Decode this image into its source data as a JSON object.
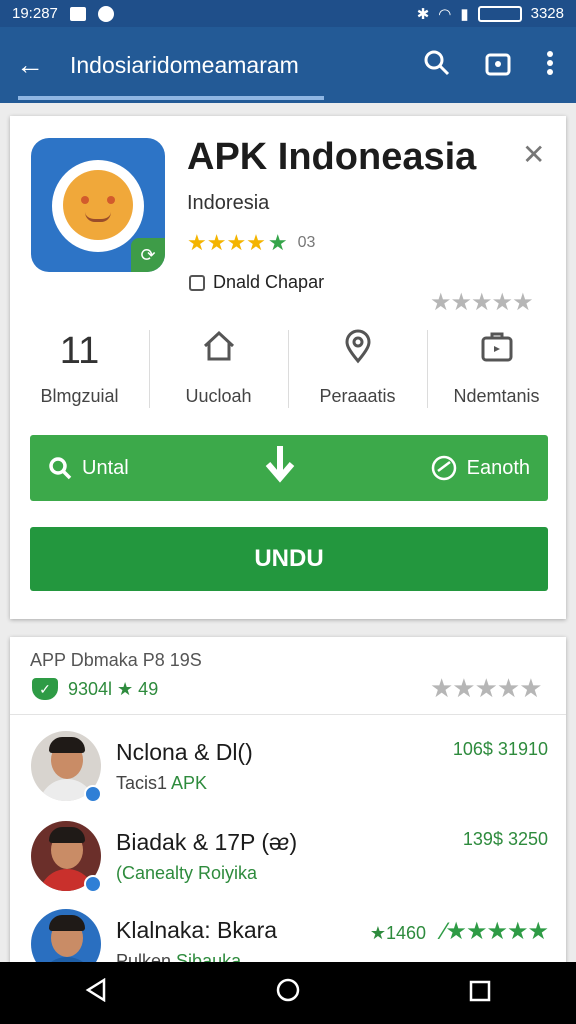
{
  "status_bar": {
    "time": "19:287",
    "battery": "3328"
  },
  "app_bar": {
    "title": "Indosiaridomeamaram"
  },
  "app": {
    "title": "APK Indoneasia",
    "developer": "Indoresia",
    "rating_count": "03",
    "dev_check_label": "Dnald Chapar"
  },
  "stats": [
    {
      "value": "11",
      "label": "Blmgzuial"
    },
    {
      "icon": "home-icon",
      "label": "Uucloah"
    },
    {
      "icon": "location-pin-icon",
      "label": "Peraaatis"
    },
    {
      "icon": "folder-icon",
      "label": "Ndemtanis"
    }
  ],
  "action_bar": {
    "left_label": "Untal",
    "right_label": "Eanoth"
  },
  "install_label": "UNDU",
  "list": {
    "header": "APP Dbmaka P8 19S",
    "sub_value": "9304l ★ 49",
    "items": [
      {
        "name": "Nclona & Dl()",
        "sub_prefix": "Tacis1 ",
        "sub_green": "APK",
        "meta": "106$ 31910",
        "shirt_color": "#ececec"
      },
      {
        "name": "Biadak & 17P (ᴂ)",
        "sub_prefix": "",
        "sub_green": "(Canealty Roiyika",
        "meta": "139$ 3250",
        "shirt_color": "#c9302c"
      },
      {
        "name": "Klalnaka: Bkara",
        "sub_prefix": "Pulken ",
        "sub_green": "Sibauka",
        "meta": "★1460",
        "shirt_color": "#1e5fa8"
      }
    ]
  },
  "colors": {
    "app_bar": "#235a96",
    "status_bar": "#1f4f8a",
    "accent_green": "#3ca94a",
    "install_green": "#23973e"
  }
}
